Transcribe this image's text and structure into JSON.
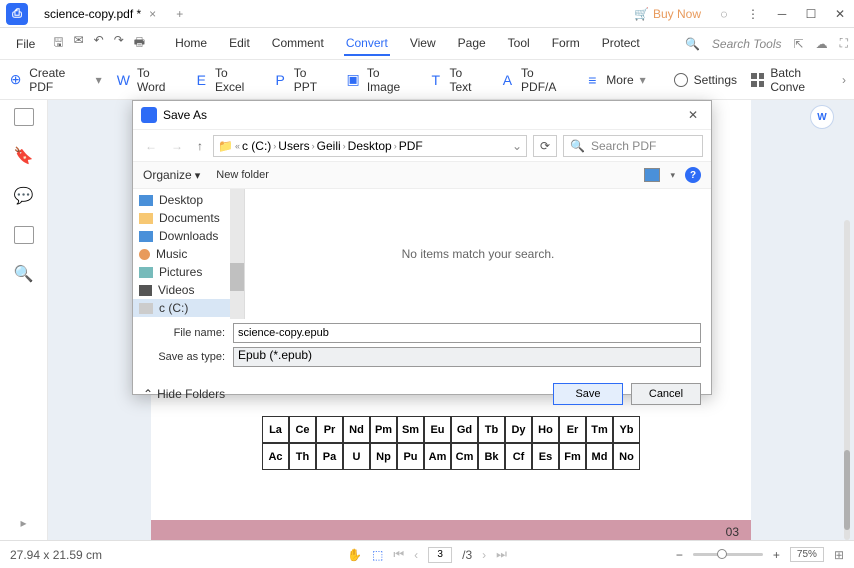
{
  "titlebar": {
    "tab_title": "science-copy.pdf *",
    "buy_now": "Buy Now"
  },
  "menubar": {
    "file": "File",
    "tabs": [
      "Home",
      "Edit",
      "Comment",
      "Convert",
      "View",
      "Page",
      "Tool",
      "Form",
      "Protect"
    ],
    "active_index": 3,
    "search_tools": "Search Tools"
  },
  "toolbar": {
    "create_pdf": "Create PDF",
    "to_word": "To Word",
    "to_excel": "To Excel",
    "to_ppt": "To PPT",
    "to_image": "To Image",
    "to_text": "To Text",
    "to_pdfa": "To PDF/A",
    "more": "More",
    "settings": "Settings",
    "batch": "Batch Conve"
  },
  "dialog": {
    "title": "Save As",
    "breadcrumb": [
      "c (C:)",
      "Users",
      "Geili",
      "Desktop",
      "PDF"
    ],
    "search_placeholder": "Search PDF",
    "organize": "Organize",
    "new_folder": "New folder",
    "tree": [
      "Desktop",
      "Documents",
      "Downloads",
      "Music",
      "Pictures",
      "Videos",
      "c (C:)"
    ],
    "empty_msg": "No items match your search.",
    "filename_label": "File name:",
    "filename_value": "science-copy.epub",
    "savetype_label": "Save as type:",
    "savetype_value": "Epub (*.epub)",
    "hide_folders": "Hide Folders",
    "save": "Save",
    "cancel": "Cancel"
  },
  "periodic": {
    "row1": [
      "La",
      "Ce",
      "Pr",
      "Nd",
      "Pm",
      "Sm",
      "Eu",
      "Gd",
      "Tb",
      "Dy",
      "Ho",
      "Er",
      "Tm",
      "Yb"
    ],
    "row2": [
      "Ac",
      "Th",
      "Pa",
      "U",
      "Np",
      "Pu",
      "Am",
      "Cm",
      "Bk",
      "Cf",
      "Es",
      "Fm",
      "Md",
      "No"
    ]
  },
  "page_number": "03",
  "statusbar": {
    "dimensions": "27.94 x 21.59 cm",
    "page_current": "3",
    "page_total": "/3",
    "zoom": "75%"
  }
}
